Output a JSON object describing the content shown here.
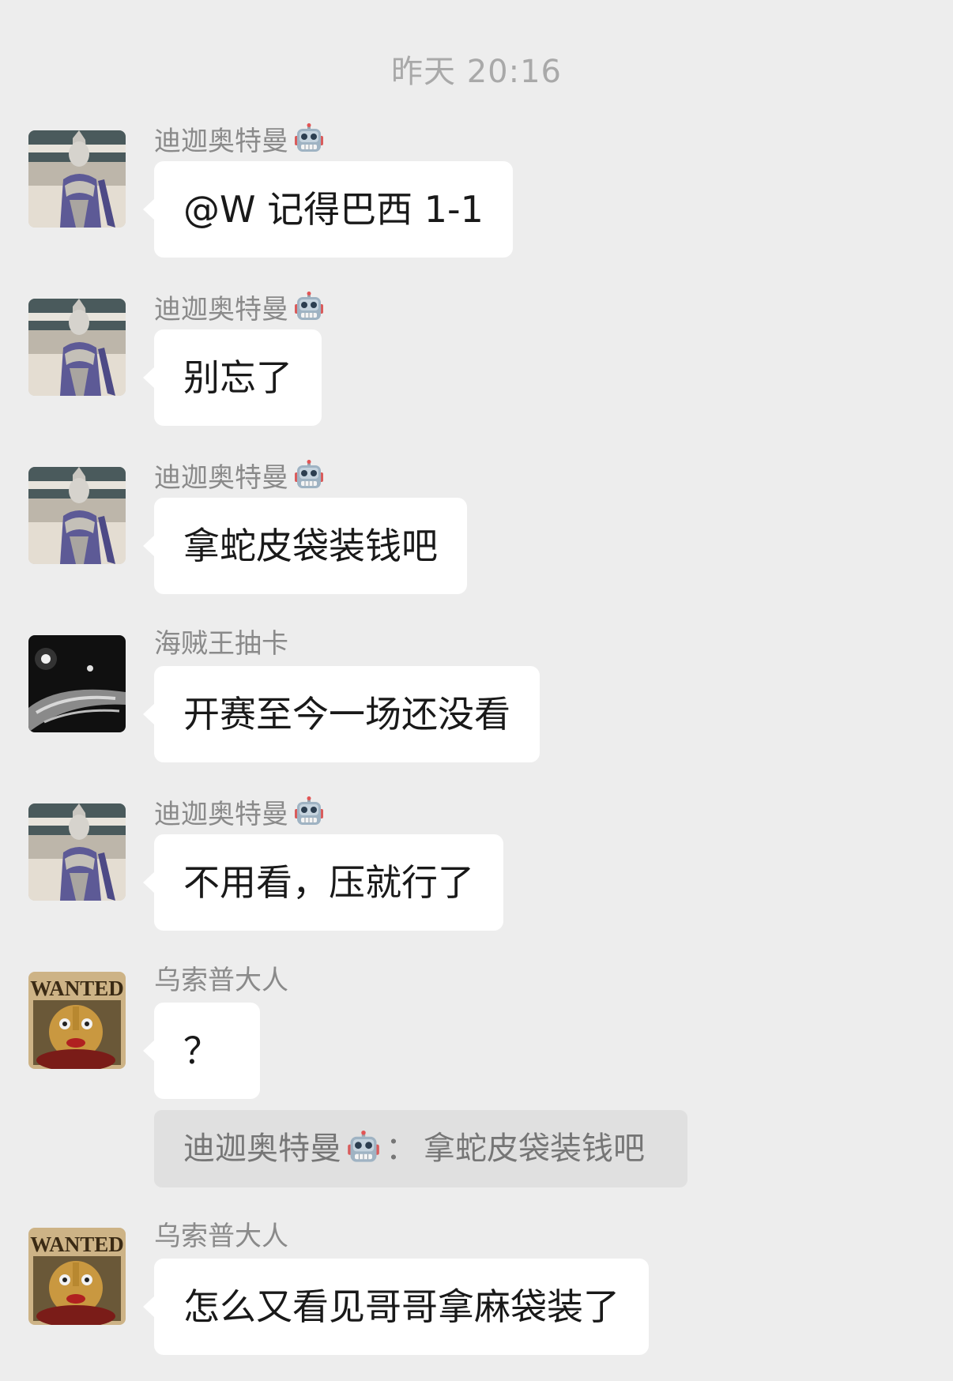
{
  "chat": {
    "timestamp": "昨天 20:16",
    "messages": [
      {
        "sender": "迪迦奥特曼",
        "sender_badge": "robot-emoji",
        "avatar": "ultraman-tiga-avatar",
        "text": "@W 记得巴西 1-1"
      },
      {
        "sender": "迪迦奥特曼",
        "sender_badge": "robot-emoji",
        "avatar": "ultraman-tiga-avatar",
        "text": "别忘了"
      },
      {
        "sender": "迪迦奥特曼",
        "sender_badge": "robot-emoji",
        "avatar": "ultraman-tiga-avatar",
        "text": "拿蛇皮袋装钱吧"
      },
      {
        "sender": "海贼王抽卡",
        "sender_badge": "",
        "avatar": "dark-photo-avatar",
        "text": "开赛至今一场还没看"
      },
      {
        "sender": "迪迦奥特曼",
        "sender_badge": "robot-emoji",
        "avatar": "ultraman-tiga-avatar",
        "text": "不用看，压就行了"
      },
      {
        "sender": "乌索普大人",
        "sender_badge": "",
        "avatar": "wanted-poster-avatar",
        "text": "？",
        "avatar_label": "WANTED"
      },
      {
        "sender": "乌索普大人",
        "sender_badge": "",
        "avatar": "wanted-poster-avatar",
        "text": "怎么又看见哥哥拿麻袋装了",
        "avatar_label": "WANTED"
      }
    ],
    "quote": {
      "sender": "迪迦奥特曼",
      "separator": "：",
      "text": "拿蛇皮袋装钱吧"
    }
  },
  "colors": {
    "background": "#ededed",
    "bubble": "#ffffff",
    "quote_bg": "#e0e0e0",
    "sender_text": "#8a8a8a",
    "timestamp_text": "#a9a9a9"
  }
}
